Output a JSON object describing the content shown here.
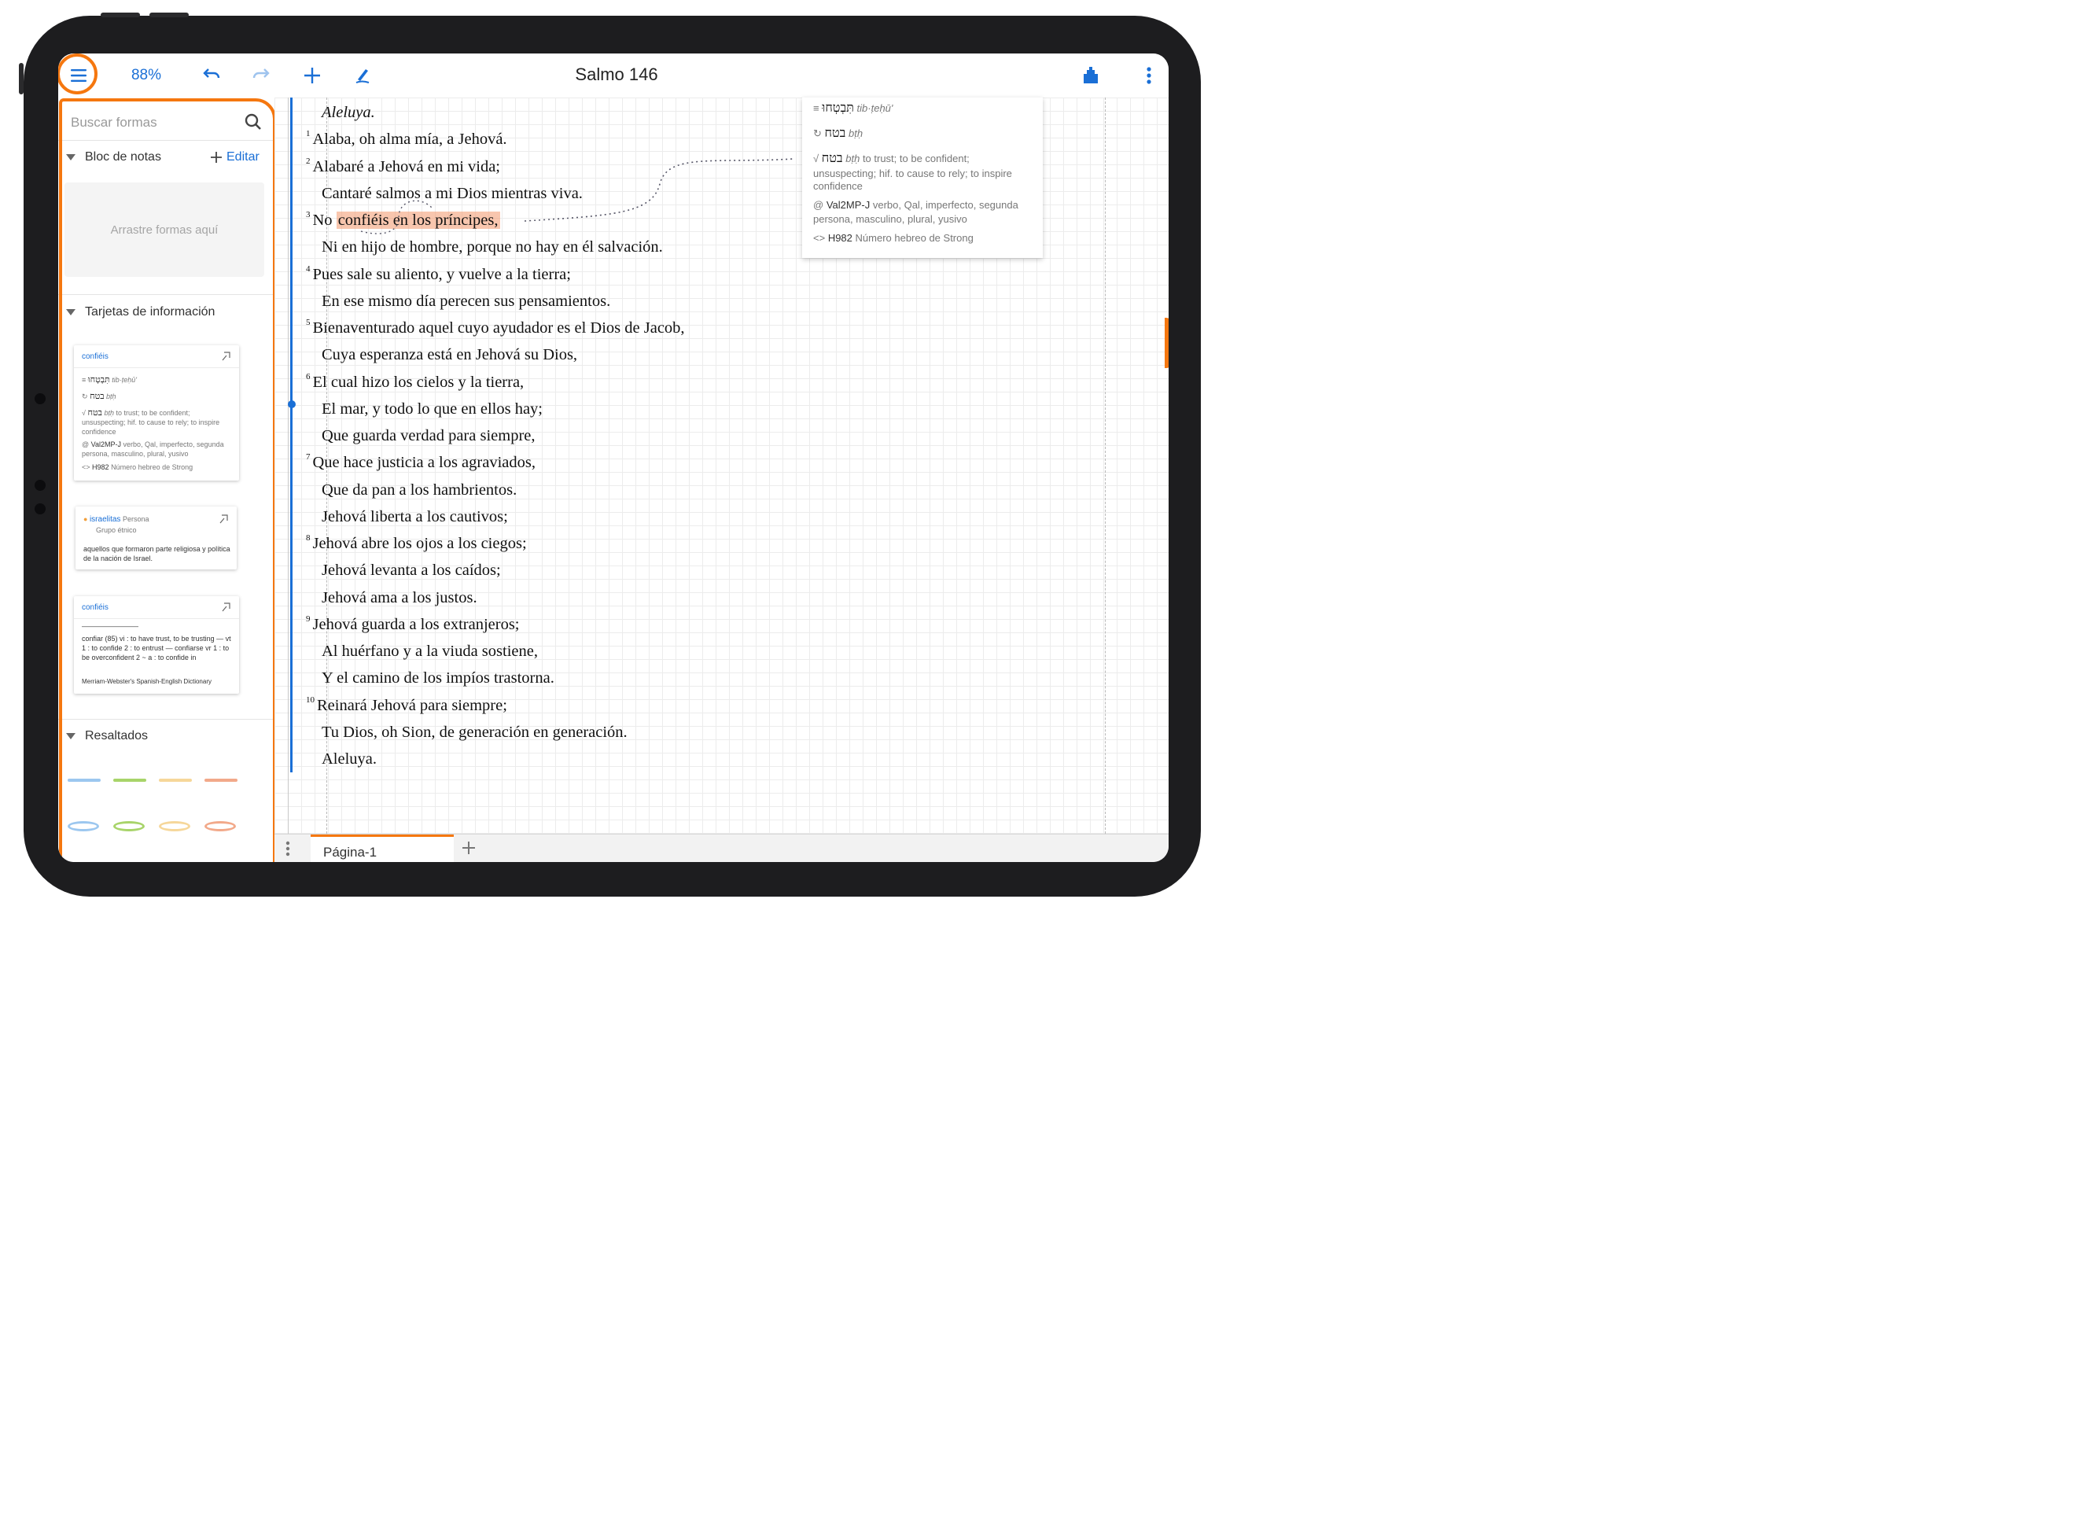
{
  "toolbar": {
    "zoom": "88%",
    "title": "Salmo 146"
  },
  "sidebar": {
    "search_placeholder": "Buscar formas",
    "notepad": {
      "title": "Bloc de notas",
      "edit_label": "Editar",
      "dropzone": "Arrastre formas aquí"
    },
    "info_cards_title": "Tarjetas de información",
    "highlights_title": "Resaltados",
    "card1": {
      "title": "confiéis",
      "r1_heb": "תִּבְטְחוּ",
      "r1_translit": "tib·ṭeḥū'",
      "r2_heb": "בטח",
      "r2_translit": "bṭḥ",
      "r3_heb": "בטח",
      "r3_translit": "bṭḥ",
      "r3_text": "to trust; to be confident; unsuspecting; hif. to cause to rely; to inspire confidence",
      "r4_code": "Val2MP-J",
      "r4_text": "verbo, Qal, imperfecto, segunda persona, masculino, plural, yusivo",
      "r5_code": "H982",
      "r5_text": "Número hebreo de Strong"
    },
    "card2": {
      "title": "israelitas",
      "type": "Persona",
      "subtype": "Grupo étnico",
      "body": "aquellos que formaron parte religiosa y política de la nación de Israel."
    },
    "card3": {
      "title": "confiéis",
      "rule": "————————",
      "body": "confiar (85) vi : to have trust, to be trusting — vt 1 : to confide 2 : to entrust — confiarse vr 1 : to be overconfident 2 ~ a : to confide in",
      "source": "Merriam-Webster's Spanish-English Dictionary"
    },
    "highlight_colors": [
      "#9cc7ef",
      "#a8d46a",
      "#f6d79a",
      "#f2a98a"
    ]
  },
  "document": {
    "verses": [
      {
        "num": "",
        "text": "Aleluya.",
        "italic": true
      },
      {
        "num": "1",
        "text": "Alaba, oh alma mía, a Jehová."
      },
      {
        "num": "2",
        "text": "Alabaré a Jehová en mi vida;"
      },
      {
        "num": "",
        "text": "Cantaré salmos a mi Dios mientras viva."
      },
      {
        "num": "3",
        "text_pre": "No ",
        "text_mark": "confiéis en los príncipes,",
        "text": ""
      },
      {
        "num": "",
        "text": "Ni en hijo de hombre, porque no hay en él salvación."
      },
      {
        "num": "4",
        "text": "Pues sale su aliento, y vuelve a la tierra;"
      },
      {
        "num": "",
        "text": "En ese mismo día perecen sus pensamientos."
      },
      {
        "num": "5",
        "text": "Bienaventurado aquel cuyo ayudador es el Dios de Jacob,"
      },
      {
        "num": "",
        "text": "Cuya esperanza está en Jehová su Dios,"
      },
      {
        "num": "6",
        "text": "El cual hizo los cielos y la tierra,"
      },
      {
        "num": "",
        "text": "El mar, y todo lo que en ellos hay;"
      },
      {
        "num": "",
        "text": "Que guarda verdad para siempre,"
      },
      {
        "num": "7",
        "text": "Que hace justicia a los agraviados,"
      },
      {
        "num": "",
        "text": "Que da pan a los hambrientos."
      },
      {
        "num": "",
        "text": "Jehová liberta a los cautivos;"
      },
      {
        "num": "8",
        "text": "Jehová abre los ojos a los ciegos;"
      },
      {
        "num": "",
        "text": "Jehová levanta a los caídos;"
      },
      {
        "num": "",
        "text": "Jehová ama a los justos."
      },
      {
        "num": "9",
        "text": "Jehová guarda a los extranjeros;"
      },
      {
        "num": "",
        "text": "Al huérfano y a la viuda sostiene,"
      },
      {
        "num": "",
        "text": "Y el camino de los impíos trastorna."
      },
      {
        "num": "10",
        "text": "Reinará Jehová para siempre;"
      },
      {
        "num": "",
        "text": "Tu Dios, oh Sion, de generación en generación."
      },
      {
        "num": "",
        "text": "Aleluya."
      }
    ]
  },
  "popup": {
    "r1_heb": "תִּבְטְחוּ",
    "r1_translit": "tib·ṭeḥū'",
    "r2_heb": "בטח",
    "r2_translit": "bṭḥ",
    "r3_heb": "בטח",
    "r3_translit": "bṭḥ",
    "r3_text": "to trust; to be confident;",
    "r3_text2": "unsuspecting; hif. to cause to rely; to inspire",
    "r3_text3": "confidence",
    "r4_code": "Val2MP-J",
    "r4_text": "verbo, Qal, imperfecto, segunda",
    "r4_text2": "persona, masculino, plural, yusivo",
    "r5_code": "H982",
    "r5_text": "Número hebreo de Strong"
  },
  "tabs": {
    "page_tab": "Página-1"
  }
}
